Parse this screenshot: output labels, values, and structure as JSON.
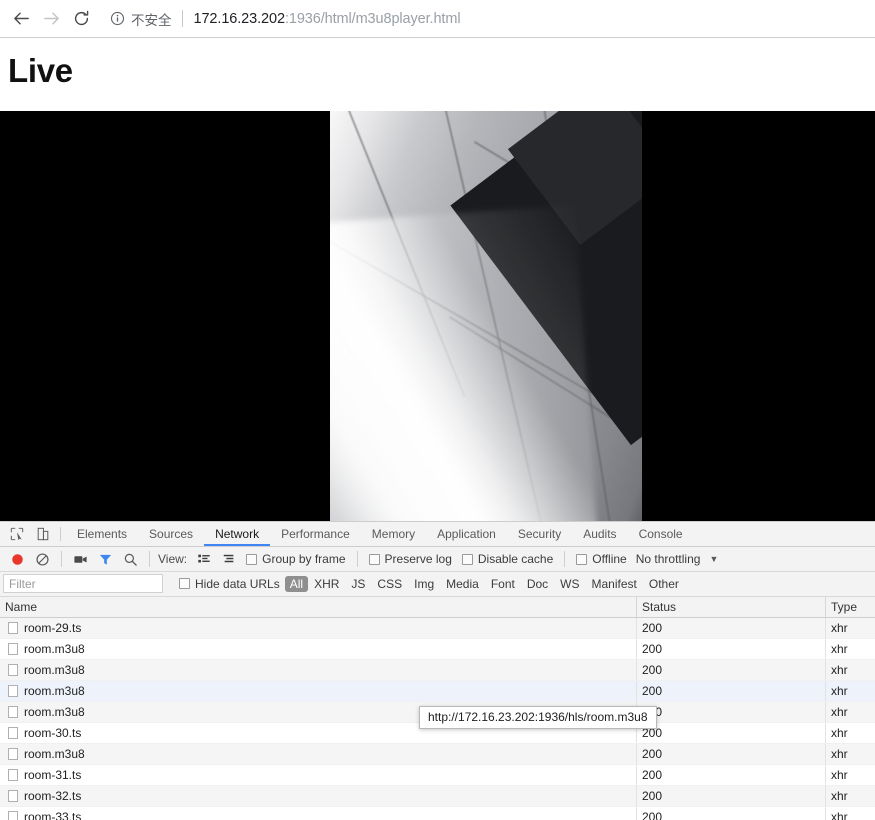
{
  "browser": {
    "back_label": "Back",
    "forward_label": "Forward",
    "reload_label": "Reload",
    "security_text": "不安全",
    "url_host": "172.16.23.202",
    "url_rest": ":1936/html/m3u8player.html"
  },
  "page": {
    "title": "Live",
    "video_alt": "live-video-stream"
  },
  "devtools": {
    "tabs": [
      {
        "label": "Elements",
        "active": false
      },
      {
        "label": "Sources",
        "active": false
      },
      {
        "label": "Network",
        "active": true
      },
      {
        "label": "Performance",
        "active": false
      },
      {
        "label": "Memory",
        "active": false
      },
      {
        "label": "Application",
        "active": false
      },
      {
        "label": "Security",
        "active": false
      },
      {
        "label": "Audits",
        "active": false
      },
      {
        "label": "Console",
        "active": false
      }
    ],
    "toolbar": {
      "view_label": "View:",
      "group_by_frame": "Group by frame",
      "preserve_log": "Preserve log",
      "disable_cache": "Disable cache",
      "offline": "Offline",
      "throttling": "No throttling"
    },
    "filterbar": {
      "filter_placeholder": "Filter",
      "hide_data_urls": "Hide data URLs",
      "types": [
        "All",
        "XHR",
        "JS",
        "CSS",
        "Img",
        "Media",
        "Font",
        "Doc",
        "WS",
        "Manifest",
        "Other"
      ],
      "active_type": "All"
    },
    "table": {
      "columns": [
        "Name",
        "Status",
        "Type"
      ],
      "rows": [
        {
          "name": "room-29.ts",
          "status": "200",
          "type": "xhr",
          "selected": false
        },
        {
          "name": "room.m3u8",
          "status": "200",
          "type": "xhr",
          "selected": false
        },
        {
          "name": "room.m3u8",
          "status": "200",
          "type": "xhr",
          "selected": false
        },
        {
          "name": "room.m3u8",
          "status": "200",
          "type": "xhr",
          "selected": true
        },
        {
          "name": "room.m3u8",
          "status": "200",
          "type": "xhr",
          "selected": false
        },
        {
          "name": "room-30.ts",
          "status": "200",
          "type": "xhr",
          "selected": false
        },
        {
          "name": "room.m3u8",
          "status": "200",
          "type": "xhr",
          "selected": false
        },
        {
          "name": "room-31.ts",
          "status": "200",
          "type": "xhr",
          "selected": false
        },
        {
          "name": "room-32.ts",
          "status": "200",
          "type": "xhr",
          "selected": false
        },
        {
          "name": "room-33.ts",
          "status": "200",
          "type": "xhr",
          "selected": false
        }
      ]
    },
    "tooltip": {
      "text": "http://172.16.23.202:1936/hls/room.m3u8"
    }
  },
  "colors": {
    "accent": "#4285f4",
    "record_active": "#e8362a",
    "filter_active": "#3b87f0",
    "selection": "#eef2fb"
  }
}
